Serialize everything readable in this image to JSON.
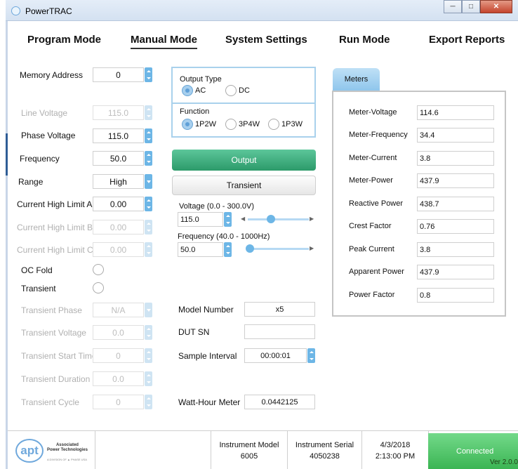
{
  "window": {
    "title": "PowerTRAC",
    "minimize": "─",
    "maximize": "□",
    "close": "✕"
  },
  "nav": {
    "items": [
      "Program Mode",
      "Manual Mode",
      "System Settings",
      "Run Mode",
      "Export Reports"
    ],
    "active": "Manual Mode"
  },
  "left": {
    "memory_address": {
      "label": "Memory Address",
      "value": "0"
    },
    "line_voltage": {
      "label": "Line Voltage",
      "value": "115.0"
    },
    "phase_voltage": {
      "label": "Phase Voltage",
      "value": "115.0"
    },
    "frequency": {
      "label": "Frequency",
      "value": "50.0"
    },
    "range": {
      "label": "Range",
      "value": "High"
    },
    "current_high_a": {
      "label": "Current High Limit A",
      "value": "0.00"
    },
    "current_high_b": {
      "label": "Current High Limit B",
      "value": "0.00"
    },
    "current_high_c": {
      "label": "Current High Limit C",
      "value": "0.00"
    },
    "oc_fold": {
      "label": "OC Fold"
    },
    "transient": {
      "label": "Transient"
    },
    "transient_phase": {
      "label": "Transient Phase",
      "value": "N/A"
    },
    "transient_voltage": {
      "label": "Transient Voltage",
      "value": "0.0"
    },
    "transient_start": {
      "label": "Transient Start Time",
      "value": "0"
    },
    "transient_duration": {
      "label": "Transient Duration",
      "value": "0.0"
    },
    "transient_cycle": {
      "label": "Transient Cycle",
      "value": "0"
    }
  },
  "middle": {
    "output_type": {
      "title": "Output Type",
      "options": [
        "AC",
        "DC"
      ],
      "selected": "AC"
    },
    "function": {
      "title": "Function",
      "options": [
        "1P2W",
        "3P4W",
        "1P3W"
      ],
      "selected": "1P2W"
    },
    "output_button": "Output",
    "transient_button": "Transient",
    "voltage": {
      "label": "Voltage (0.0 - 300.0V)",
      "value": "115.0",
      "slider_fraction": 0.38
    },
    "frequency": {
      "label": "Frequency (40.0 - 1000Hz)",
      "value": "50.0",
      "slider_fraction": 0.01
    },
    "model_number": {
      "label": "Model Number",
      "value": "x5"
    },
    "dut_sn": {
      "label": "DUT SN",
      "value": ""
    },
    "sample_interval": {
      "label": "Sample Interval",
      "value": "00:00:01"
    },
    "watt_hour": {
      "label": "Watt-Hour Meter",
      "value": "0.0442125"
    }
  },
  "meters": {
    "tab": "Meters",
    "rows": [
      {
        "label": "Meter-Voltage",
        "value": "114.6"
      },
      {
        "label": "Meter-Frequency",
        "value": "34.4"
      },
      {
        "label": "Meter-Current",
        "value": "3.8"
      },
      {
        "label": "Meter-Power",
        "value": "437.9"
      },
      {
        "label": "Reactive Power",
        "value": "438.7"
      },
      {
        "label": "Crest Factor",
        "value": "0.76"
      },
      {
        "label": "Peak Current",
        "value": "3.8"
      },
      {
        "label": "Apparent Power",
        "value": "437.9"
      },
      {
        "label": "Power Factor",
        "value": "0.8"
      }
    ]
  },
  "status": {
    "logo_mark": "apt",
    "logo_name_1": "Associated",
    "logo_name_2": "Power Technologies",
    "logo_sub": "A DIVISION OF ▲ PHASE USA",
    "instrument_model_label": "Instrument Model",
    "instrument_model": "6005",
    "instrument_serial_label": "Instrument Serial",
    "instrument_serial": "4050238",
    "date": "4/3/2018",
    "time": "2:13:00 PM",
    "connection": "Connected",
    "version": "Ver 2.0.0"
  },
  "colors": {
    "accent_blue": "#6db6e6",
    "output_green": "#2c9a6a",
    "connected_green": "#3bb553",
    "group_border": "#a9d1ec"
  }
}
